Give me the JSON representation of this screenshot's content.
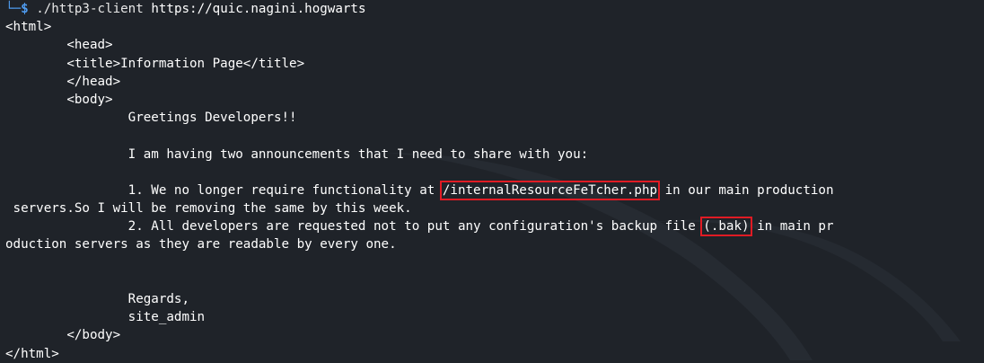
{
  "prompt": {
    "corner": "└─",
    "symbol": "$",
    "command": "./http3-client",
    "argument": "https://quic.nagini.hogwarts"
  },
  "output": {
    "html_open": "<html>",
    "head_open": "        <head>",
    "title_line": "        <title>Information Page</title>",
    "head_close": "        </head>",
    "body_open": "        <body>",
    "greeting": "                Greetings Developers!!",
    "blank1": "",
    "intro": "                I am having two announcements that I need to share with you:",
    "blank2": "",
    "item1_prefix": "                1. We no longer require functionality at ",
    "item1_highlight": "/internalResourceFeTcher.php",
    "item1_suffix": " in our main production",
    "item1_cont": " servers.So I will be removing the same by this week.",
    "item2_prefix": "                2. All developers are requested not to put any configuration's backup file ",
    "item2_highlight": "(.bak)",
    "item2_suffix": " in main pr",
    "item2_cont": "oduction servers as they are readable by every one.",
    "blank3": "",
    "blank4": "",
    "regards": "                Regards,",
    "signature": "                site_admin",
    "body_close": "        </body>",
    "html_close": "</html>"
  },
  "colors": {
    "background": "#1f2329",
    "prompt_blue": "#4f9df2",
    "highlight_red": "#e01b24"
  }
}
